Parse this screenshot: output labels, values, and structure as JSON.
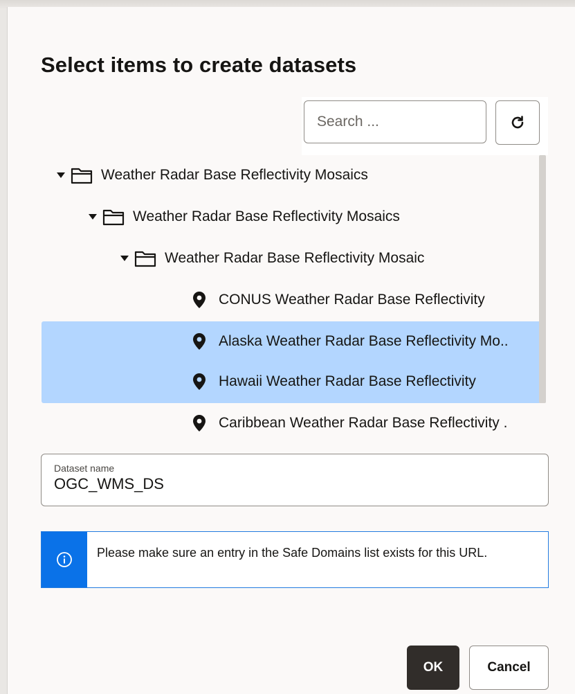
{
  "dialog": {
    "title": "Select items to create datasets"
  },
  "search": {
    "placeholder": "Search ...",
    "refresh_icon": "refresh-icon"
  },
  "tree": {
    "items": [
      {
        "label": "Weather Radar Base Reflectivity Mosaics",
        "type": "folder",
        "expanded": true,
        "level": 0
      },
      {
        "label": "Weather Radar Base Reflectivity Mosaics",
        "type": "folder",
        "expanded": true,
        "level": 1
      },
      {
        "label": "Weather Radar Base Reflectivity Mosaic",
        "type": "folder",
        "expanded": true,
        "level": 2
      },
      {
        "label": "CONUS Weather Radar Base Reflectivity",
        "type": "layer",
        "selected": false,
        "level": 3
      },
      {
        "label": "Alaska Weather Radar Base Reflectivity Mo..",
        "type": "layer",
        "selected": true,
        "level": 3
      },
      {
        "label": "Hawaii Weather Radar Base Reflectivity",
        "type": "layer",
        "selected": true,
        "level": 3
      },
      {
        "label": "Caribbean Weather Radar Base Reflectivity .",
        "type": "layer",
        "selected": false,
        "level": 3
      }
    ]
  },
  "dataset": {
    "label": "Dataset name",
    "value": "OGC_WMS_DS"
  },
  "info": {
    "message": "Please make sure an entry in the Safe Domains list exists for this URL.",
    "icon": "info-icon",
    "accent_color": "#0a72e8"
  },
  "buttons": {
    "ok": "OK",
    "cancel": "Cancel"
  },
  "colors": {
    "selection": "#b3d6ff",
    "primary_button": "#312d2a"
  }
}
